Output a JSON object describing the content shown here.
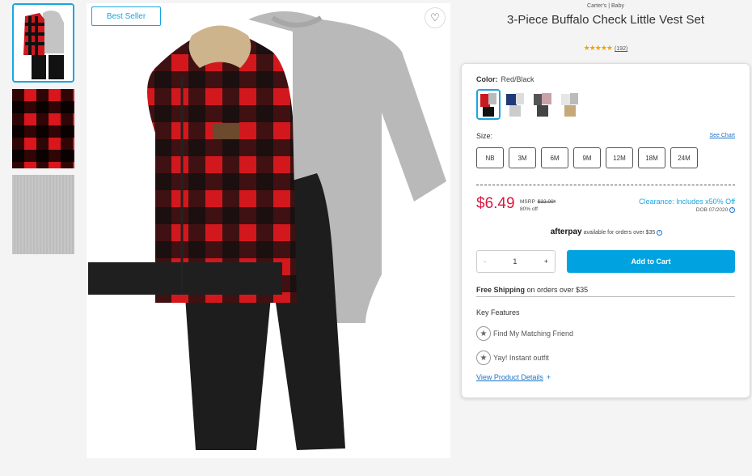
{
  "gallery": {
    "badge": "Best Seller",
    "thumbnails": [
      "main outfit",
      "buffalo check fabric",
      "grey knit fabric"
    ]
  },
  "product": {
    "brand": "Carter's | Baby",
    "title": "3-Piece Buffalo Check Little Vest Set",
    "stars": "★★★★★",
    "review_count": "(192)"
  },
  "options": {
    "color_label": "Color:",
    "color_value": "Red/Black",
    "size_label": "Size:",
    "size_chart": "See Chart",
    "sizes": [
      "NB",
      "3M",
      "6M",
      "9M",
      "12M",
      "18M",
      "24M"
    ]
  },
  "pricing": {
    "price": "$6.49",
    "msrp_label": "MSRP",
    "msrp_value": "$32.00*",
    "discount": "80% off",
    "clearance": "Clearance: Includes x50% Off",
    "dob": "DOB 07/2020",
    "info_glyph": "i"
  },
  "afterpay": {
    "brand": "afterpay",
    "text": "available for orders over $35",
    "info_glyph": "i"
  },
  "purchase": {
    "minus": "-",
    "quantity": "1",
    "plus": "+",
    "add_to_cart": "Add to Cart"
  },
  "shipping": {
    "bold": "Free Shipping",
    "text": "on orders over $35"
  },
  "features": {
    "heading": "Key Features",
    "items": [
      "Find My Matching Friend",
      "Yay! Instant outfit"
    ],
    "view_link": "View Product Details",
    "view_link_plus": "+"
  },
  "colors": {
    "accent": "#1aa5e0",
    "price": "#d6193f",
    "link": "#1a75c9",
    "button": "#00a3e0"
  },
  "icons": {
    "heart": "♡",
    "star": "★"
  }
}
